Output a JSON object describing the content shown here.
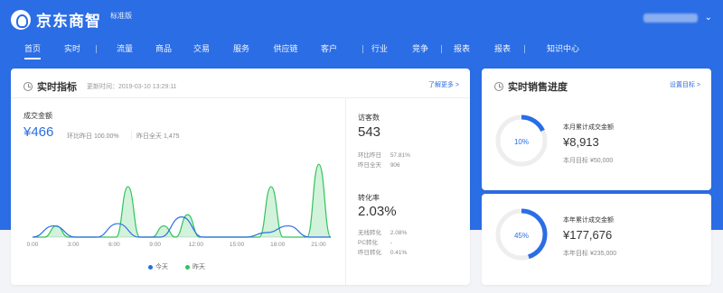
{
  "brand": {
    "name": "京东商智",
    "sub": "标准版"
  },
  "colors": {
    "primary": "#2b6de5",
    "green": "#31c35a"
  },
  "nav": {
    "items": [
      "首页",
      "实时",
      "流量",
      "商品",
      "交易",
      "服务",
      "供应链",
      "客户",
      "行业",
      "竞争",
      "报表",
      "报表",
      "知识中心"
    ],
    "active": 0
  },
  "realtime": {
    "title": "实时指标",
    "update_time": "更新时间：2019-03-10 13:29:11",
    "more": "了解更多 >",
    "gmv": {
      "label": "成交金额",
      "value": "¥466",
      "compare": "环比昨日 100.00%",
      "pv": "昨日全天 1,475"
    },
    "visitors": {
      "label": "访客数",
      "value": "543",
      "row1_k": "环比昨日",
      "row1_v": "57.81%",
      "row2_k": "昨日全天",
      "row2_v": "906"
    },
    "conversion": {
      "label": "转化率",
      "value": "2.03%",
      "row1_k": "无线转化",
      "row1_v": "2.08%",
      "row2_k": "PC转化",
      "row2_v": "-",
      "row3_k": "昨日转化",
      "row3_v": "0.41%"
    },
    "legend": {
      "today": "今天",
      "yesterday": "昨天"
    }
  },
  "chart_data": {
    "type": "area",
    "categories": [
      "0:00",
      "3:00",
      "6:00",
      "9:00",
      "12:00",
      "15:00",
      "18:00",
      "21:00"
    ],
    "series": [
      {
        "name": "今天",
        "color": "#2b6de5",
        "values": [
          0,
          10,
          0,
          0,
          12,
          0,
          0,
          18,
          0,
          0,
          0,
          4,
          10,
          0,
          0
        ]
      },
      {
        "name": "昨天",
        "color": "#31c35a",
        "values": [
          0,
          0,
          10,
          0,
          0,
          0,
          0,
          0,
          45,
          0,
          0,
          10,
          0,
          20,
          0,
          0,
          0,
          0,
          0,
          0,
          45,
          0,
          0,
          0,
          65,
          0
        ]
      }
    ]
  },
  "sales": {
    "title": "实时销售进度",
    "target_link": "设置目标 >",
    "month": {
      "pct": "10%",
      "label": "本月累计成交金额",
      "value": "¥8,913",
      "target": "本月目标 ¥50,000",
      "progress": 0.18
    },
    "year": {
      "pct": "45%",
      "label": "本年累计成交金额",
      "value": "¥177,676",
      "target": "本年目标 ¥235,000",
      "progress": 0.45
    }
  }
}
